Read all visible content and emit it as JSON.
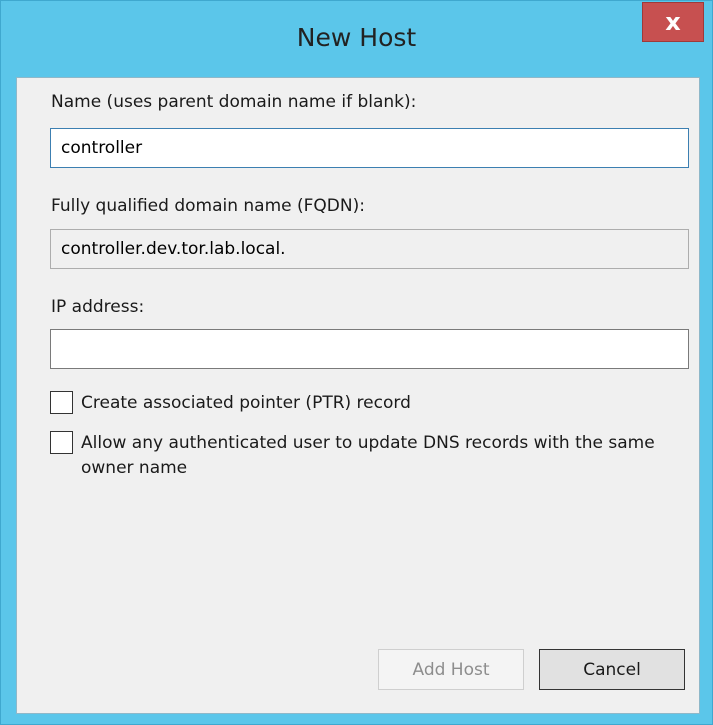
{
  "window": {
    "title": "New Host",
    "close_glyph": "x"
  },
  "form": {
    "name_label": "Name (uses parent domain name if blank):",
    "name_value": "controller",
    "fqdn_label": "Fully qualified domain name (FQDN):",
    "fqdn_value": "controller.dev.tor.lab.local.",
    "ip_label": "IP address:",
    "ip_value": "",
    "ptr_label": "Create associated pointer (PTR) record",
    "ptr_checked": false,
    "allow_label": "Allow any authenticated user to update DNS records with the same owner name",
    "allow_checked": false
  },
  "buttons": {
    "add_host": "Add Host",
    "cancel": "Cancel"
  },
  "colors": {
    "titlebar": "#5bc6ea",
    "close": "#c75050",
    "client_bg": "#f0f0f0"
  },
  "icons": {
    "close": "close-icon"
  }
}
